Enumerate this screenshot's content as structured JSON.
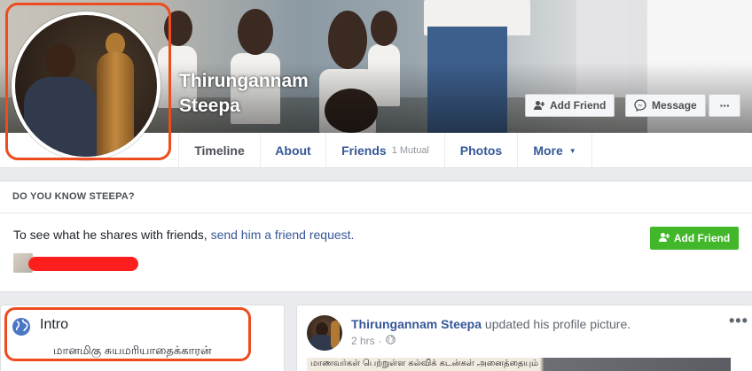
{
  "profile": {
    "first_name": "Thirungannam",
    "last_name": "Steepa",
    "add_friend_label": "Add Friend",
    "message_label": "Message",
    "more_dots": "···"
  },
  "tabs": [
    {
      "label": "Timeline"
    },
    {
      "label": "About"
    },
    {
      "label": "Friends",
      "sub": "1 Mutual"
    },
    {
      "label": "Photos"
    },
    {
      "label": "More",
      "caret": "▼"
    }
  ],
  "know": {
    "heading": "DO YOU KNOW STEEPA?",
    "text": "To see what he shares with friends, ",
    "link": "send him a friend request.",
    "button": "Add Friend"
  },
  "intro": {
    "title": "Intro",
    "bio": "மானமிகு சுயமரியாதைக்காரன்"
  },
  "post": {
    "author": "Thirungannam Steepa",
    "action": " updated his profile picture.",
    "time": "2 hrs",
    "sep": "·",
    "dots": "•••",
    "strip_text": "மாணவர்கள் பெற்றுள்ள கல்விக் கடன்கள் அனைத்தையும்"
  },
  "colors": {
    "link": "#365899",
    "annotation": "#ee4b1f",
    "green": "#42b72a",
    "redaction": "#ff1e1e"
  },
  "icons": {
    "add_friend": "add-person-icon",
    "message": "messenger-icon",
    "globe": "globe-icon",
    "audience": "globe-small-icon"
  }
}
